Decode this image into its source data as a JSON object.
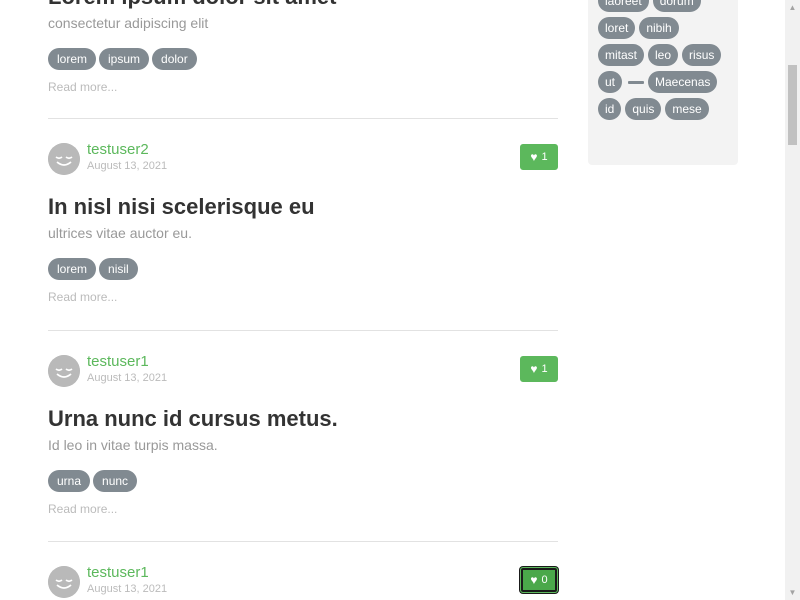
{
  "articles": [
    {
      "author": "",
      "date": "",
      "likes": "",
      "title": "Lorem ipsum dolor sit amet",
      "subtitle": "consectetur adipiscing elit",
      "tags": [
        "lorem",
        "ipsum",
        "dolor"
      ],
      "read_more": "Read more...",
      "partial_top": true
    },
    {
      "author": "testuser2",
      "date": "August 13, 2021",
      "likes": "1",
      "title": "In nisl nisi scelerisque eu",
      "subtitle": "ultrices vitae auctor eu.",
      "tags": [
        "lorem",
        "nisil"
      ],
      "read_more": "Read more..."
    },
    {
      "author": "testuser1",
      "date": "August 13, 2021",
      "likes": "1",
      "title": "Urna nunc id cursus metus.",
      "subtitle": "Id leo in vitae turpis massa.",
      "tags": [
        "urna",
        "nunc"
      ],
      "read_more": "Read more..."
    },
    {
      "author": "testuser1",
      "date": "August 13, 2021",
      "likes": "0",
      "title": "",
      "subtitle": "",
      "tags": [],
      "read_more": ""
    }
  ],
  "sidebar": {
    "tags": [
      "laoreet",
      "dorum",
      "loret",
      "nibih",
      "mitast",
      "leo",
      "risus",
      "ut",
      "Maecenas",
      "id",
      "quis",
      "mese"
    ]
  },
  "colors": {
    "accent": "#5cb85c",
    "tag_bg": "#818a91",
    "sidebar_bg": "#f3f3f3"
  },
  "icons": {
    "like": "heart-icon",
    "avatar": "smiley-avatar-icon"
  }
}
